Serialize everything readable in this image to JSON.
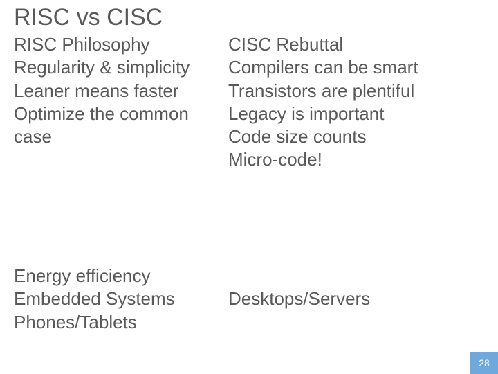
{
  "title": "RISC vs CISC",
  "left": {
    "heading": "RISC Philosophy",
    "lines": [
      "Regularity & simplicity",
      "Leaner means faster",
      "Optimize the common case"
    ],
    "apps": [
      "Energy efficiency",
      "Embedded Systems",
      "Phones/Tablets"
    ]
  },
  "right": {
    "heading": "CISC Rebuttal",
    "lines": [
      "Compilers can be smart",
      "Transistors are plentiful",
      "Legacy is important",
      "Code size counts",
      "Micro-code!"
    ],
    "apps": [
      "Desktops/Servers"
    ]
  },
  "page": "28"
}
